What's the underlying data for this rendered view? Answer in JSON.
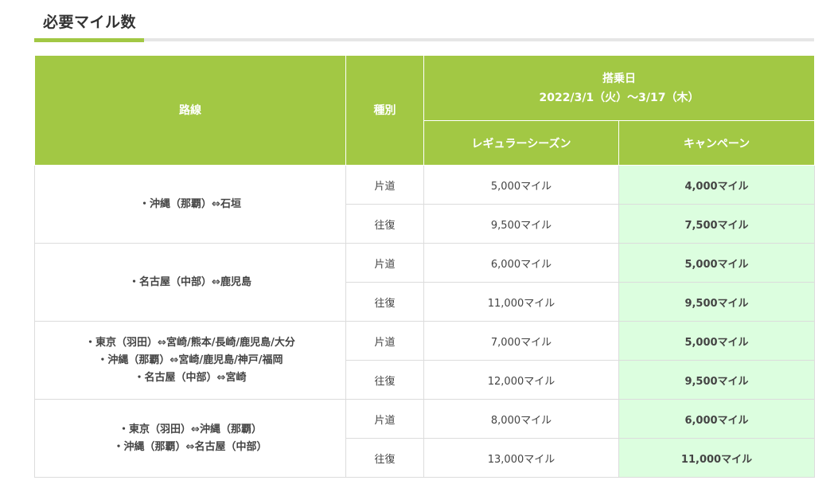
{
  "page": {
    "title": "必要マイル数"
  },
  "table": {
    "headers": {
      "route": "路線",
      "type": "種別",
      "boarding_date_label": "搭乗日",
      "boarding_date_range": "2022/3/1（火）～3/17（木）",
      "regular": "レギュラーシーズン",
      "campaign": "キャンペーン"
    },
    "groups": [
      {
        "routes": [
          "・沖縄（那覇）⇔石垣"
        ],
        "rows": [
          {
            "type": "片道",
            "regular": "5,000マイル",
            "campaign": "4,000マイル"
          },
          {
            "type": "往復",
            "regular": "9,500マイル",
            "campaign": "7,500マイル"
          }
        ]
      },
      {
        "routes": [
          "・名古屋（中部）⇔鹿児島"
        ],
        "rows": [
          {
            "type": "片道",
            "regular": "6,000マイル",
            "campaign": "5,000マイル"
          },
          {
            "type": "往復",
            "regular": "11,000マイル",
            "campaign": "9,500マイル"
          }
        ]
      },
      {
        "routes": [
          "・東京（羽田）⇔宮崎/熊本/長崎/鹿児島/大分",
          "・沖縄（那覇）⇔宮崎/鹿児島/神戸/福岡",
          "・名古屋（中部）⇔宮崎"
        ],
        "rows": [
          {
            "type": "片道",
            "regular": "7,000マイル",
            "campaign": "5,000マイル"
          },
          {
            "type": "往復",
            "regular": "12,000マイル",
            "campaign": "9,500マイル"
          }
        ]
      },
      {
        "routes": [
          "・東京（羽田）⇔沖縄（那覇）",
          "・沖縄（那覇）⇔名古屋（中部）"
        ],
        "rows": [
          {
            "type": "片道",
            "regular": "8,000マイル",
            "campaign": "6,000マイル"
          },
          {
            "type": "往復",
            "regular": "13,000マイル",
            "campaign": "11,000マイル"
          }
        ]
      }
    ]
  },
  "colors": {
    "header_bg": "#a2c844",
    "campaign_bg": "#dcfedf",
    "campaign_text": "#e60012"
  }
}
